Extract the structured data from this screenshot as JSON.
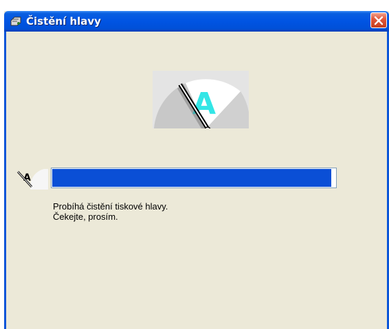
{
  "window": {
    "title": "Čistění hlavy",
    "title_icon": "printer-icon",
    "close_icon": "close-icon",
    "accent_color": "#0054e3"
  },
  "illustration": {
    "icon": "print-head-wiper-icon",
    "letter": "A"
  },
  "progress": {
    "icon": "wiper-small-icon",
    "icon_letter": "A",
    "fraction": 0.985,
    "fill_color": "#0a4fd6"
  },
  "message": {
    "line1": "Probíhá čistění tiskové hlavy.",
    "line2": "Čekejte, prosím."
  }
}
